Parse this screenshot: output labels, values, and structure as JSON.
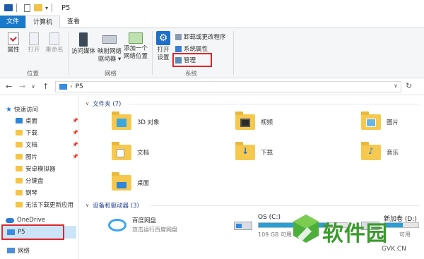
{
  "titlebar": {
    "title": "P5",
    "qa_arrow": "▾"
  },
  "tabs": {
    "file": "文件",
    "computer": "计算机",
    "view": "查看"
  },
  "ribbon": {
    "properties": "属性",
    "open": "打开",
    "rename": "重命名",
    "access_media": "访问媒体",
    "map_drive_l1": "映射网络",
    "map_drive_l2": "驱动器 ▾",
    "add_location_l1": "添加一个",
    "add_location_l2": "网络位置",
    "open_settings_l1": "打开",
    "open_settings_l2": "设置",
    "uninstall": "卸载或更改程序",
    "system_props": "系统属性",
    "manage": "管理",
    "group_location": "位置",
    "group_network": "网络",
    "group_system": "系统"
  },
  "address": {
    "back": "←",
    "forward": "→",
    "dropdown": "∨",
    "up": "↑",
    "path_sep": "›",
    "path": "P5",
    "refresh": "↻"
  },
  "sidebar": {
    "quick_access": "快速访问",
    "items": [
      "桌面",
      "下载",
      "文档",
      "图片",
      "安卓模拟器",
      "分键盘",
      "钢琴",
      "无法下载更新应用"
    ],
    "onedrive": "OneDrive",
    "this_pc": "P5",
    "network": "网络"
  },
  "content": {
    "folders_header": "文件夹 (7)",
    "folders": [
      "3D 对象",
      "视频",
      "图片",
      "文档",
      "下载",
      "音乐",
      "桌面"
    ],
    "devices_header": "设备和驱动器 (3)",
    "baidu_name": "百度网盘",
    "baidu_sub": "双击运行百度网盘",
    "drive_c_name": "OS (C:)",
    "drive_c_free": "109 GB 可用",
    "drive_c_used_fraction": 0.78,
    "drive_d_name": "新加卷 (D:)",
    "drive_d_free": "可用",
    "drive_d_used_fraction": 0.55
  },
  "watermark": {
    "text": "软件园",
    "sub": "GVK.CN"
  },
  "colors": {
    "accent": "#1979ca",
    "highlight": "#e0262b",
    "folder": "#f6c94e",
    "selection": "#cce4f7"
  }
}
